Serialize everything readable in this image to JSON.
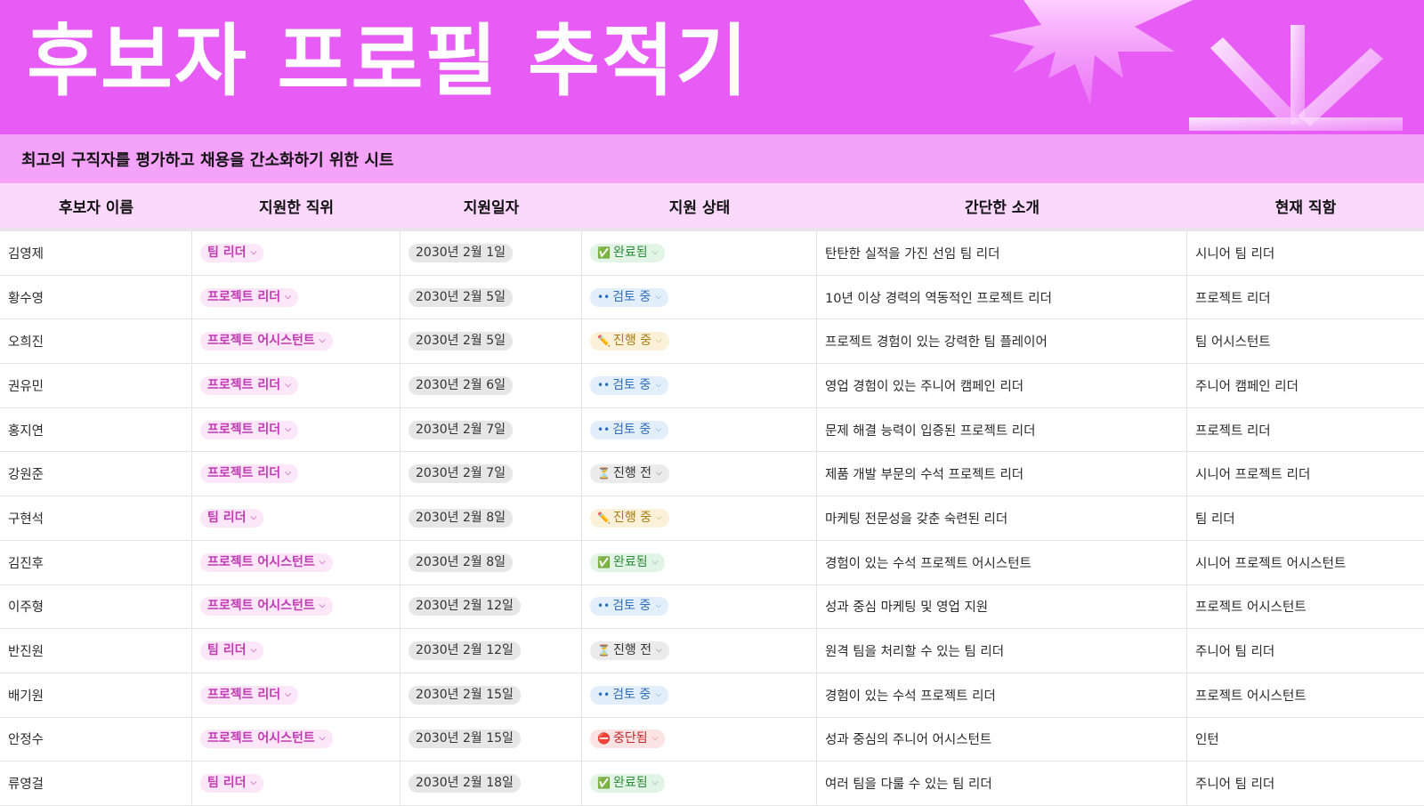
{
  "header": {
    "title": "후보자 프로필 추적기",
    "subtitle": "최고의 구직자를 평가하고 채용을 간소화하기 위한 시트"
  },
  "columns": [
    "후보자 이름",
    "지원한 직위",
    "지원일자",
    "지원 상태",
    "간단한 소개",
    "현재 직함"
  ],
  "status_icons": {
    "done": "✅",
    "review": "••",
    "progress": "✏️",
    "pending": "⏳",
    "stopped": "⛔"
  },
  "rows": [
    {
      "name": "김영제",
      "position": "팀 리더",
      "date": "2030년 2월 1일",
      "status": "완료됨",
      "status_type": "done",
      "intro": "탄탄한 실적을 가진 선임 팀 리더",
      "title": "시니어 팀 리더"
    },
    {
      "name": "황수영",
      "position": "프로젝트 리더",
      "date": "2030년 2월 5일",
      "status": "검토 중",
      "status_type": "review",
      "intro": "10년 이상 경력의 역동적인 프로젝트 리더",
      "title": "프로젝트 리더"
    },
    {
      "name": "오희진",
      "position": "프로젝트 어시스턴트",
      "date": "2030년 2월 5일",
      "status": "진행 중",
      "status_type": "progress",
      "intro": "프로젝트 경험이 있는 강력한 팀 플레이어",
      "title": "팀 어시스턴트"
    },
    {
      "name": "권유민",
      "position": "프로젝트 리더",
      "date": "2030년 2월 6일",
      "status": "검토 중",
      "status_type": "review",
      "intro": "영업 경험이 있는 주니어 캠페인 리더",
      "title": "주니어 캠페인 리더"
    },
    {
      "name": "홍지연",
      "position": "프로젝트 리더",
      "date": "2030년 2월 7일",
      "status": "검토 중",
      "status_type": "review",
      "intro": "문제 해결 능력이 입증된 프로젝트 리더",
      "title": "프로젝트 리더"
    },
    {
      "name": "강원준",
      "position": "프로젝트 리더",
      "date": "2030년 2월 7일",
      "status": "진행 전",
      "status_type": "pending",
      "intro": "제품 개발 부문의 수석 프로젝트 리더",
      "title": "시니어 프로젝트 리더"
    },
    {
      "name": "구현석",
      "position": "팀 리더",
      "date": "2030년 2월 8일",
      "status": "진행 중",
      "status_type": "progress",
      "intro": "마케팅 전문성을 갖춘 숙련된 리더",
      "title": "팀 리더"
    },
    {
      "name": "김진후",
      "position": "프로젝트 어시스턴트",
      "date": "2030년 2월 8일",
      "status": "완료됨",
      "status_type": "done",
      "intro": "경험이 있는 수석 프로젝트 어시스턴트",
      "title": "시니어 프로젝트 어시스턴트"
    },
    {
      "name": "이주형",
      "position": "프로젝트 어시스턴트",
      "date": "2030년 2월 12일",
      "status": "검토 중",
      "status_type": "review",
      "intro": "성과 중심 마케팅 및 영업 지원",
      "title": "프로젝트 어시스턴트"
    },
    {
      "name": "반진원",
      "position": "팀 리더",
      "date": "2030년 2월 12일",
      "status": "진행 전",
      "status_type": "pending",
      "intro": "원격 팀을 처리할 수 있는 팀 리더",
      "title": "주니어 팀 리더"
    },
    {
      "name": "배기원",
      "position": "프로젝트 리더",
      "date": "2030년 2월 15일",
      "status": "검토 중",
      "status_type": "review",
      "intro": "경험이 있는 수석 프로젝트 리더",
      "title": "프로젝트 어시스턴트"
    },
    {
      "name": "안정수",
      "position": "프로젝트 어시스턴트",
      "date": "2030년 2월 15일",
      "status": "중단됨",
      "status_type": "stopped",
      "intro": "성과 중심의 주니어 어시스턴트",
      "title": "인턴"
    },
    {
      "name": "류영걸",
      "position": "팀 리더",
      "date": "2030년 2월 18일",
      "status": "완료됨",
      "status_type": "done",
      "intro": "여러 팀을 다룰 수 있는 팀 리더",
      "title": "주니어 팀 리더"
    }
  ]
}
